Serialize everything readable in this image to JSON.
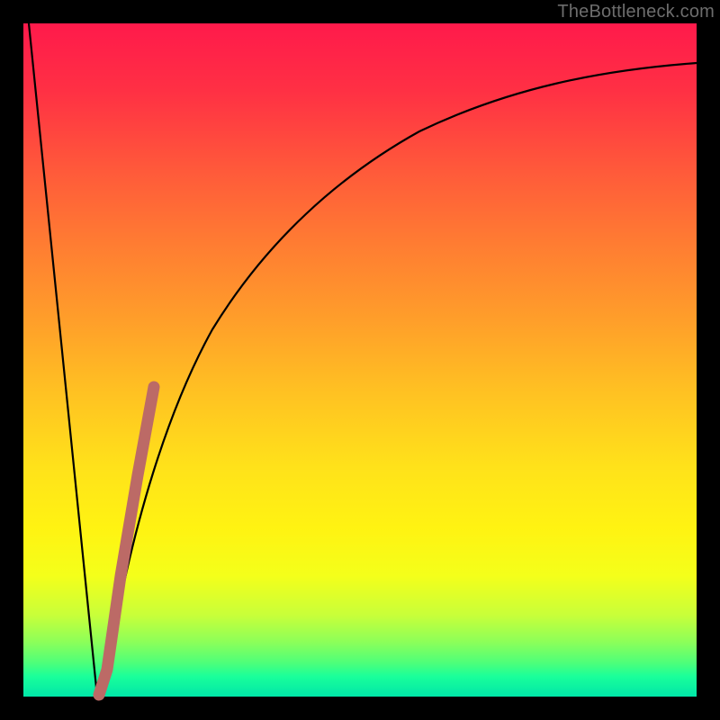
{
  "watermark": "TheBottleneck.com",
  "colors": {
    "curve_stroke": "#000000",
    "highlight_stroke": "#bc6a66",
    "frame_bg": "#000000"
  },
  "chart_data": {
    "type": "line",
    "title": "",
    "xlabel": "",
    "ylabel": "",
    "xlim": [
      0,
      100
    ],
    "ylim": [
      0,
      100
    ],
    "grid": false,
    "legend": false,
    "series": [
      {
        "name": "bottleneck-curve",
        "x": [
          0,
          11,
          13,
          16,
          19,
          25,
          33,
          45,
          58,
          72,
          86,
          100
        ],
        "y": [
          100,
          0,
          7,
          25,
          41,
          60,
          73,
          82,
          88,
          91,
          93,
          94
        ]
      },
      {
        "name": "highlight-segment",
        "x": [
          11,
          12.5,
          14.5,
          17,
          19.5
        ],
        "y": [
          0,
          4,
          18,
          33,
          46
        ]
      }
    ]
  }
}
